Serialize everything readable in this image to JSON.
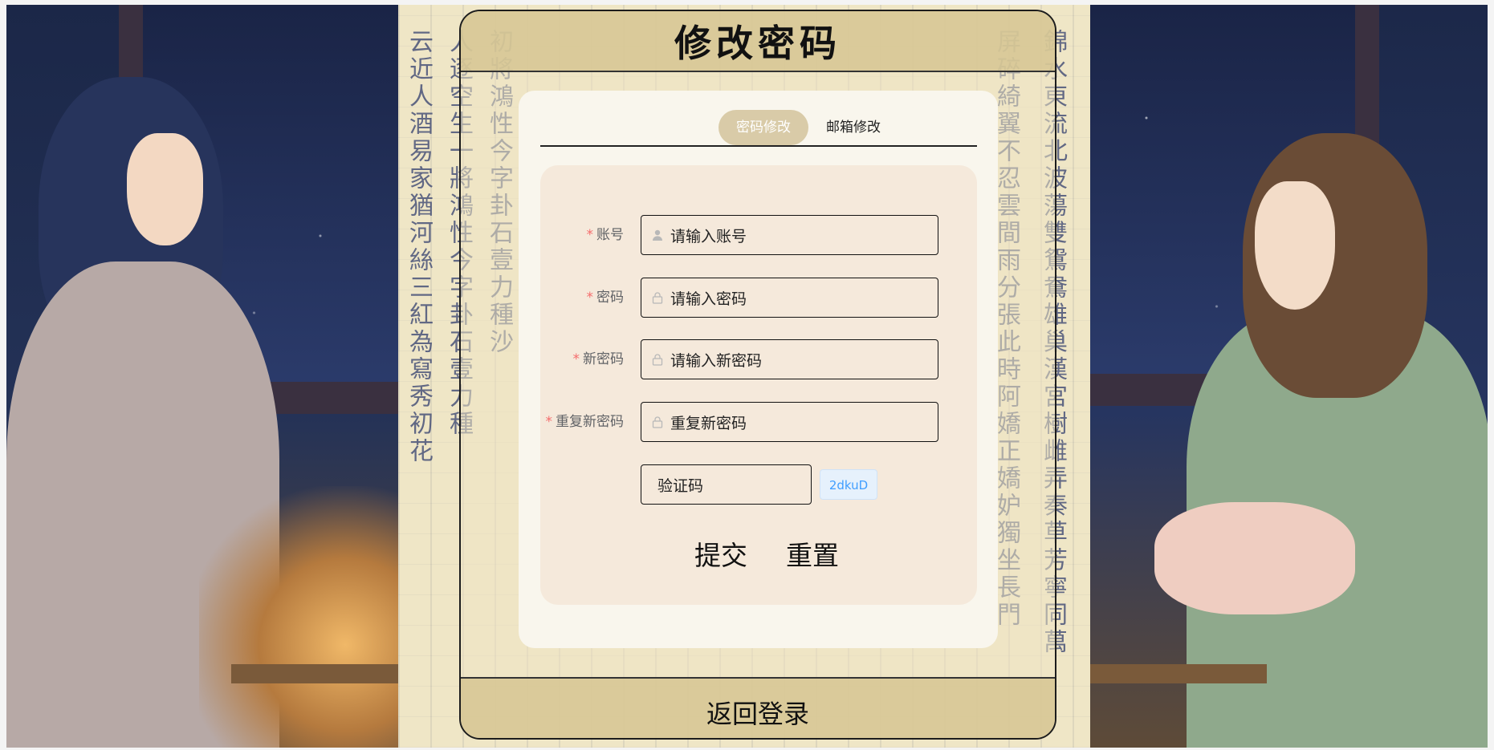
{
  "header": {
    "title": "修改密码"
  },
  "tabs": [
    {
      "label": "密码修改",
      "active": true
    },
    {
      "label": "邮箱修改",
      "active": false
    }
  ],
  "form": {
    "account": {
      "label": "账号",
      "placeholder": "请输入账号",
      "icon": "user-icon"
    },
    "password": {
      "label": "密码",
      "placeholder": "请输入密码",
      "icon": "lock-icon"
    },
    "new_password": {
      "label": "新密码",
      "placeholder": "请输入新密码",
      "icon": "lock-icon"
    },
    "repeat_password": {
      "label": "重复新密码",
      "placeholder": "重复新密码",
      "icon": "lock-icon"
    },
    "captcha": {
      "placeholder": "验证码",
      "code": "2dkuD"
    },
    "required_mark": "*"
  },
  "buttons": {
    "submit": "提交",
    "reset": "重置"
  },
  "footer": {
    "back_label": "返回登录"
  },
  "colors": {
    "header_bg": "#d6c692",
    "tab_active_bg": "#d9cba8",
    "form_bg": "#f5e9db",
    "required": "#f56c6c",
    "captcha_text": "#409eff"
  }
}
